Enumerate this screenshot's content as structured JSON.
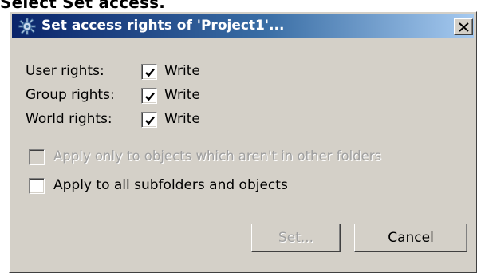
{
  "page": {
    "cropped_instruction": "Select Set access."
  },
  "dialog": {
    "title": "Set access rights of 'Project1'...",
    "title_icon": "gear-icon",
    "close_icon": "close-icon",
    "rights": [
      {
        "label": "User rights:",
        "checkbox_label": "Write",
        "checked": true
      },
      {
        "label": "Group rights:",
        "checkbox_label": "Write",
        "checked": true
      },
      {
        "label": "World rights:",
        "checkbox_label": "Write",
        "checked": true
      }
    ],
    "options": [
      {
        "label": "Apply only to objects which aren't in other folders",
        "checked": false,
        "disabled": true
      },
      {
        "label": "Apply to all subfolders and objects",
        "checked": false,
        "disabled": false
      }
    ],
    "buttons": {
      "set": "Set...",
      "cancel": "Cancel"
    }
  },
  "colors": {
    "titlebar_start": "#0a246a",
    "titlebar_end": "#a6caf0",
    "dialog_bg": "#d4d0c8",
    "disabled_text": "#a0a0a0"
  }
}
